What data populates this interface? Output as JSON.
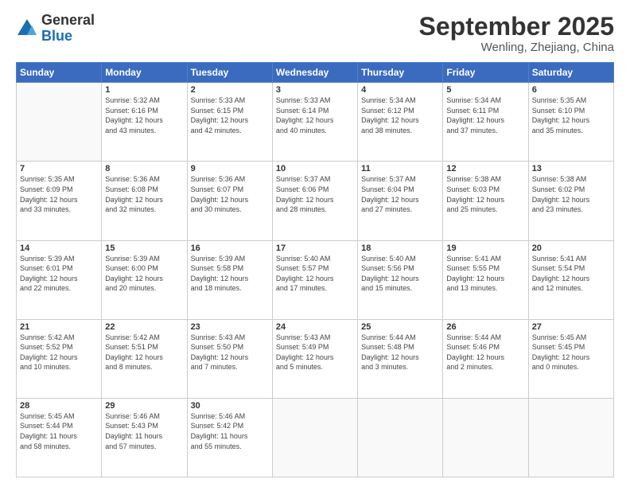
{
  "header": {
    "logo_line1": "General",
    "logo_line2": "Blue",
    "month": "September 2025",
    "location": "Wenling, Zhejiang, China"
  },
  "days_of_week": [
    "Sunday",
    "Monday",
    "Tuesday",
    "Wednesday",
    "Thursday",
    "Friday",
    "Saturday"
  ],
  "weeks": [
    [
      {
        "day": "",
        "info": ""
      },
      {
        "day": "1",
        "info": "Sunrise: 5:32 AM\nSunset: 6:16 PM\nDaylight: 12 hours\nand 43 minutes."
      },
      {
        "day": "2",
        "info": "Sunrise: 5:33 AM\nSunset: 6:15 PM\nDaylight: 12 hours\nand 42 minutes."
      },
      {
        "day": "3",
        "info": "Sunrise: 5:33 AM\nSunset: 6:14 PM\nDaylight: 12 hours\nand 40 minutes."
      },
      {
        "day": "4",
        "info": "Sunrise: 5:34 AM\nSunset: 6:12 PM\nDaylight: 12 hours\nand 38 minutes."
      },
      {
        "day": "5",
        "info": "Sunrise: 5:34 AM\nSunset: 6:11 PM\nDaylight: 12 hours\nand 37 minutes."
      },
      {
        "day": "6",
        "info": "Sunrise: 5:35 AM\nSunset: 6:10 PM\nDaylight: 12 hours\nand 35 minutes."
      }
    ],
    [
      {
        "day": "7",
        "info": "Sunrise: 5:35 AM\nSunset: 6:09 PM\nDaylight: 12 hours\nand 33 minutes."
      },
      {
        "day": "8",
        "info": "Sunrise: 5:36 AM\nSunset: 6:08 PM\nDaylight: 12 hours\nand 32 minutes."
      },
      {
        "day": "9",
        "info": "Sunrise: 5:36 AM\nSunset: 6:07 PM\nDaylight: 12 hours\nand 30 minutes."
      },
      {
        "day": "10",
        "info": "Sunrise: 5:37 AM\nSunset: 6:06 PM\nDaylight: 12 hours\nand 28 minutes."
      },
      {
        "day": "11",
        "info": "Sunrise: 5:37 AM\nSunset: 6:04 PM\nDaylight: 12 hours\nand 27 minutes."
      },
      {
        "day": "12",
        "info": "Sunrise: 5:38 AM\nSunset: 6:03 PM\nDaylight: 12 hours\nand 25 minutes."
      },
      {
        "day": "13",
        "info": "Sunrise: 5:38 AM\nSunset: 6:02 PM\nDaylight: 12 hours\nand 23 minutes."
      }
    ],
    [
      {
        "day": "14",
        "info": "Sunrise: 5:39 AM\nSunset: 6:01 PM\nDaylight: 12 hours\nand 22 minutes."
      },
      {
        "day": "15",
        "info": "Sunrise: 5:39 AM\nSunset: 6:00 PM\nDaylight: 12 hours\nand 20 minutes."
      },
      {
        "day": "16",
        "info": "Sunrise: 5:39 AM\nSunset: 5:58 PM\nDaylight: 12 hours\nand 18 minutes."
      },
      {
        "day": "17",
        "info": "Sunrise: 5:40 AM\nSunset: 5:57 PM\nDaylight: 12 hours\nand 17 minutes."
      },
      {
        "day": "18",
        "info": "Sunrise: 5:40 AM\nSunset: 5:56 PM\nDaylight: 12 hours\nand 15 minutes."
      },
      {
        "day": "19",
        "info": "Sunrise: 5:41 AM\nSunset: 5:55 PM\nDaylight: 12 hours\nand 13 minutes."
      },
      {
        "day": "20",
        "info": "Sunrise: 5:41 AM\nSunset: 5:54 PM\nDaylight: 12 hours\nand 12 minutes."
      }
    ],
    [
      {
        "day": "21",
        "info": "Sunrise: 5:42 AM\nSunset: 5:52 PM\nDaylight: 12 hours\nand 10 minutes."
      },
      {
        "day": "22",
        "info": "Sunrise: 5:42 AM\nSunset: 5:51 PM\nDaylight: 12 hours\nand 8 minutes."
      },
      {
        "day": "23",
        "info": "Sunrise: 5:43 AM\nSunset: 5:50 PM\nDaylight: 12 hours\nand 7 minutes."
      },
      {
        "day": "24",
        "info": "Sunrise: 5:43 AM\nSunset: 5:49 PM\nDaylight: 12 hours\nand 5 minutes."
      },
      {
        "day": "25",
        "info": "Sunrise: 5:44 AM\nSunset: 5:48 PM\nDaylight: 12 hours\nand 3 minutes."
      },
      {
        "day": "26",
        "info": "Sunrise: 5:44 AM\nSunset: 5:46 PM\nDaylight: 12 hours\nand 2 minutes."
      },
      {
        "day": "27",
        "info": "Sunrise: 5:45 AM\nSunset: 5:45 PM\nDaylight: 12 hours\nand 0 minutes."
      }
    ],
    [
      {
        "day": "28",
        "info": "Sunrise: 5:45 AM\nSunset: 5:44 PM\nDaylight: 11 hours\nand 58 minutes."
      },
      {
        "day": "29",
        "info": "Sunrise: 5:46 AM\nSunset: 5:43 PM\nDaylight: 11 hours\nand 57 minutes."
      },
      {
        "day": "30",
        "info": "Sunrise: 5:46 AM\nSunset: 5:42 PM\nDaylight: 11 hours\nand 55 minutes."
      },
      {
        "day": "",
        "info": ""
      },
      {
        "day": "",
        "info": ""
      },
      {
        "day": "",
        "info": ""
      },
      {
        "day": "",
        "info": ""
      }
    ]
  ]
}
